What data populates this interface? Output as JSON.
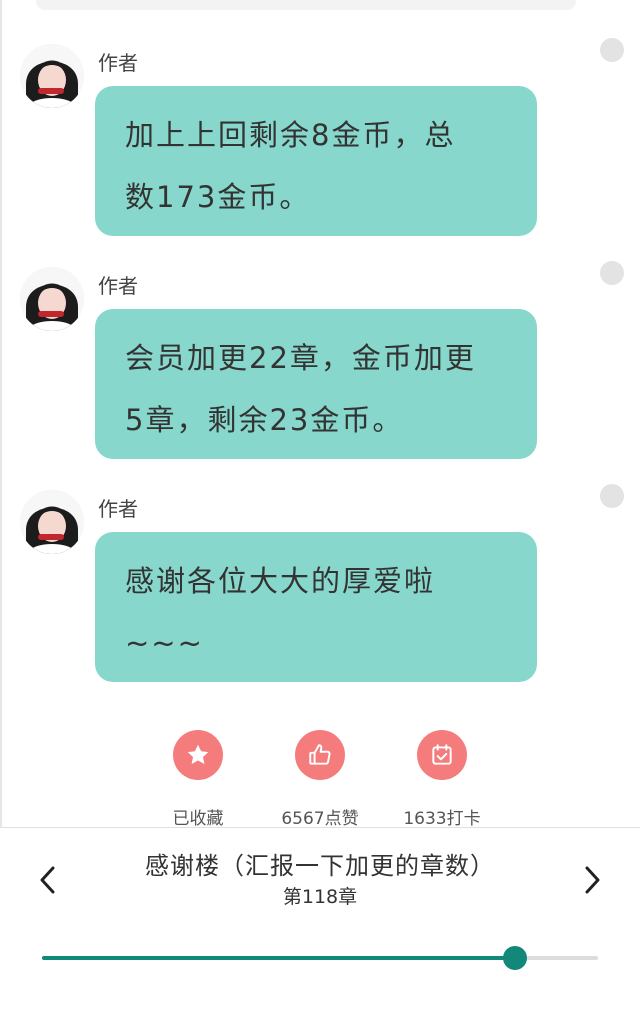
{
  "messages": [
    {
      "author": "作者",
      "lines": [
        "加上上回剩余8金币，总",
        "数173金币。"
      ]
    },
    {
      "author": "作者",
      "lines": [
        "会员加更22章，金币加更",
        "5章，剩余23金币。"
      ]
    },
    {
      "author": "作者",
      "lines": [
        "感谢各位大大的厚爱啦",
        "~~~"
      ]
    }
  ],
  "actions": {
    "favorite": {
      "label": "已收藏",
      "icon": "star-icon"
    },
    "like": {
      "label": "6567点赞",
      "icon": "thumbs-up-icon"
    },
    "checkin": {
      "label": "1633打卡",
      "icon": "calendar-check-icon"
    }
  },
  "footer": {
    "title": "感谢楼（汇报一下加更的章数）",
    "chapter": "第118章",
    "progress": 0.85
  },
  "colors": {
    "bubble": "#87d7cc",
    "accent": "#11887a",
    "action": "#f47c7c"
  }
}
